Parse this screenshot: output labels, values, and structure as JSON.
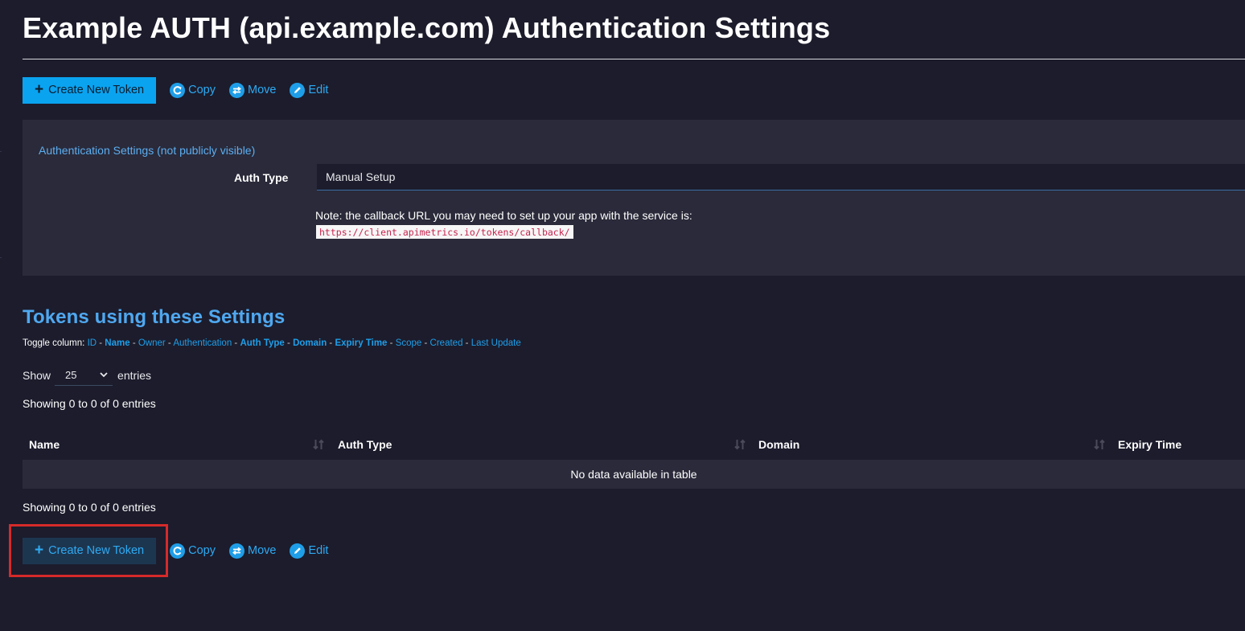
{
  "page_title": "Example AUTH (api.example.com) Authentication Settings",
  "toolbar": {
    "create_label": "Create New Token",
    "copy_label": "Copy",
    "move_label": "Move",
    "edit_label": "Edit"
  },
  "settings_panel": {
    "heading": "Authentication Settings (not publicly visible)",
    "auth_type_label": "Auth Type",
    "auth_type_value": "Manual Setup",
    "note": "Note: the callback URL you may need to set up your app with the service is:",
    "callback_url": "https://client.apimetrics.io/tokens/callback/"
  },
  "tokens": {
    "heading": "Tokens using these Settings",
    "toggle_label": "Toggle column:",
    "toggle_columns": [
      {
        "label": "ID",
        "active": false
      },
      {
        "label": "Name",
        "active": true
      },
      {
        "label": "Owner",
        "active": false
      },
      {
        "label": "Authentication",
        "active": false
      },
      {
        "label": "Auth Type",
        "active": true
      },
      {
        "label": "Domain",
        "active": true
      },
      {
        "label": "Expiry Time",
        "active": true
      },
      {
        "label": "Scope",
        "active": false
      },
      {
        "label": "Created",
        "active": false
      },
      {
        "label": "Last Update",
        "active": false
      }
    ],
    "show_label": "Show",
    "entries_label": "entries",
    "page_length": "25",
    "info_top": "Showing 0 to 0 of 0 entries",
    "info_bottom": "Showing 0 to 0 of 0 entries",
    "columns": [
      "Name",
      "Auth Type",
      "Domain",
      "Expiry Time"
    ],
    "empty_message": "No data available in table"
  },
  "colors": {
    "background": "#1c1c2c",
    "panel": "#2a2a3a",
    "accent": "#0aa3f0",
    "link": "#2eaaf2",
    "highlight": "#d52a2a"
  }
}
